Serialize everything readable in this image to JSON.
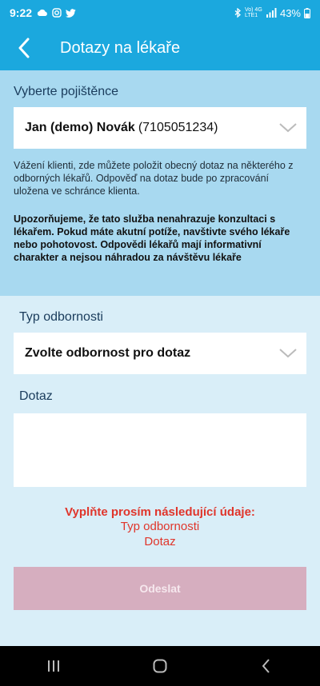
{
  "status_bar": {
    "time": "9:22",
    "battery": "43%",
    "network": "Vo) 4G LTE1"
  },
  "header": {
    "title": "Dotazy na lékaře",
    "back_icon": "chevron-left-icon"
  },
  "insured": {
    "label": "Vyberte pojištěnce",
    "name": "Jan (demo) Novák",
    "id": "(7105051234)"
  },
  "info": {
    "text": "Vážení klienti, zde můžete položit obecný dotaz na některého z odborných lékařů. Odpověď na dotaz bude po zpracování uložena ve schránce klienta.",
    "warning": "Upozorňujeme, že tato služba nenahrazuje konzultaci s lékařem. Pokud máte akutní potíže, navštivte svého lékaře nebo pohotovost. Odpovědi lékařů mají informativní charakter a nejsou náhradou za návštěvu lékaře"
  },
  "specialty": {
    "label": "Typ odbornosti",
    "placeholder": "Zvolte odbornost pro dotaz"
  },
  "question": {
    "label": "Dotaz",
    "value": ""
  },
  "validation": {
    "heading": "Vyplňte prosím následující údaje:",
    "items": [
      "Typ odbornosti",
      "Dotaz"
    ]
  },
  "submit_label": "Odeslat",
  "colors": {
    "primary": "#1ba8de",
    "section_bg": "#a8d9f0",
    "page_bg": "#d9eef8",
    "error": "#e0352b",
    "button_disabled": "#d6aebf"
  }
}
